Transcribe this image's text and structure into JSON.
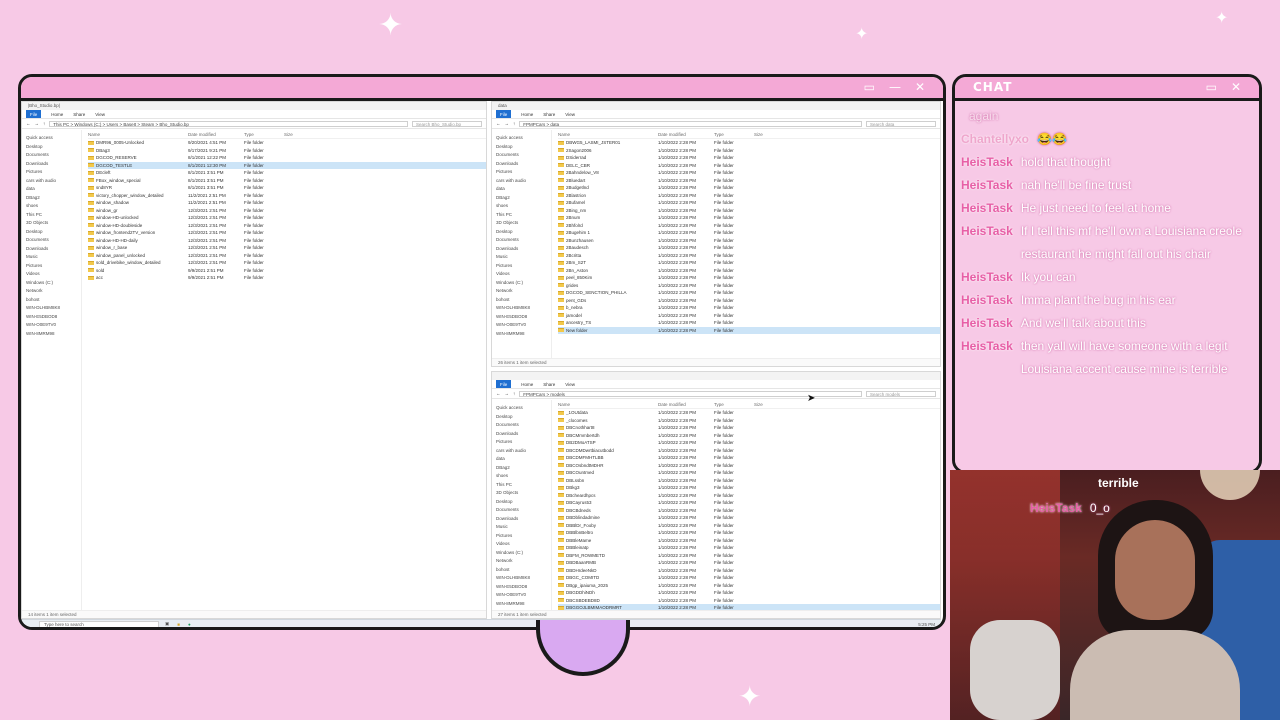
{
  "chat": {
    "title": "CHAT",
    "messages": [
      {
        "user": "",
        "text": "",
        "faded": true
      },
      {
        "user": "",
        "text": "again",
        "faded": true
      },
      {
        "user": "Chantellyxo",
        "text": "😂😂",
        "faded": true
      },
      {
        "user": "HeisTask",
        "text": "hold that thought"
      },
      {
        "user": "HeisTask",
        "text": "nah he'll be fine trust"
      },
      {
        "user": "HeisTask",
        "text": "He just need to feel at home"
      },
      {
        "user": "HeisTask",
        "text": "If I tell this mf he'll own a Louisiana creole restaurant he might fall out his chair"
      },
      {
        "user": "HeisTask",
        "text": "Ik you can"
      },
      {
        "user": "HeisTask",
        "text": "Imma plant the bug in his ear"
      },
      {
        "user": "HeisTask",
        "text": "And we'll talk about this"
      },
      {
        "user": "HeisTask",
        "text": "then yall will have someone with a legit Louisiana accent cause mine is terrible"
      }
    ],
    "overlay_last": {
      "user": "HeisTask",
      "text": "0_o"
    },
    "overlay_prev_text": "terrible"
  },
  "explorer_left": {
    "title": "|Bho_Studio.bp|",
    "ribbon": [
      "File",
      "Home",
      "Share",
      "View"
    ],
    "path": "This PC  >  Windows (C:)  >  Users  >  BaseIt  >  Steam  >  Bho_Studio.bp",
    "search": "Search Bho_Studio.bp",
    "nav": [
      "Quick access",
      "Desktop",
      "Documents",
      "Downloads",
      "Pictures",
      "cars with audio",
      "data",
      "DBag2",
      "shoes",
      "This PC",
      "3D Objects",
      "Desktop",
      "Documents",
      "Downloads",
      "Music",
      "Pictures",
      "Videos",
      "Windows (C:)",
      "Network",
      "bohost",
      "WIN-DLHBM8K8",
      "WIN-E5DBOD8",
      "WIN-O0E9TV0",
      "WIN-8MRM98"
    ],
    "headers": [
      "Name",
      "Date modified",
      "Type",
      "Size"
    ],
    "rows": [
      {
        "name": "DMR96_0005-Unlocked",
        "date": "9/20/2021 4:51 PM",
        "type": "File folder"
      },
      {
        "name": "DBag3",
        "date": "9/17/2021 9:21 PM",
        "type": "File folder"
      },
      {
        "name": "DGCOD_RESERVE",
        "date": "8/1/2021 12:22 PM",
        "type": "File folder"
      },
      {
        "name": "DGCOD_TESTLE",
        "date": "8/1/2021 12:30 PM",
        "type": "File folder",
        "selected": true
      },
      {
        "name": "DEcleft",
        "date": "8/1/2021 3:51 PM",
        "type": "File folder"
      },
      {
        "name": "FBox_window_special",
        "date": "8/1/2021 3:51 PM",
        "type": "File folder"
      },
      {
        "name": "snd8YR",
        "date": "8/1/2021 3:51 PM",
        "type": "File folder"
      },
      {
        "name": "victory_chopper_window_detailed",
        "date": "11/2/2021 2:51 PM",
        "type": "File folder"
      },
      {
        "name": "window_shadow",
        "date": "11/2/2021 2:51 PM",
        "type": "File folder"
      },
      {
        "name": "window_gr",
        "date": "12/3/2021 2:51 PM",
        "type": "File folder"
      },
      {
        "name": "window-HD-unlocked",
        "date": "12/3/2021 2:51 PM",
        "type": "File folder"
      },
      {
        "name": "window-HD-doubleside",
        "date": "12/3/2021 2:51 PM",
        "type": "File folder"
      },
      {
        "name": "window_frontend2TV_version",
        "date": "12/3/2021 2:51 PM",
        "type": "File folder"
      },
      {
        "name": "window-HD-HD-daily",
        "date": "12/3/2021 2:51 PM",
        "type": "File folder"
      },
      {
        "name": "window_r_base",
        "date": "12/3/2021 2:51 PM",
        "type": "File folder"
      },
      {
        "name": "window_panel_unlocked",
        "date": "12/3/2021 2:51 PM",
        "type": "File folder"
      },
      {
        "name": "sold_drivebike_window_detailed",
        "date": "12/3/2021 2:51 PM",
        "type": "File folder"
      },
      {
        "name": "sold",
        "date": "9/9/2021 2:51 PM",
        "type": "File folder"
      },
      {
        "name": "acc",
        "date": "9/9/2021 2:51 PM",
        "type": "File folder"
      }
    ],
    "status": "14 items  1 item selected"
  },
  "explorer_tr": {
    "title": "data",
    "ribbon": [
      "File",
      "Home",
      "Share",
      "View"
    ],
    "path": "FPMPCars  >  data",
    "search": "Search data",
    "nav": [
      "Quick access",
      "Desktop",
      "Documents",
      "Downloads",
      "Pictures",
      "cars with audio",
      "data",
      "DBag2",
      "shoes",
      "This PC",
      "3D Objects",
      "Desktop",
      "Documents",
      "Downloads",
      "Music",
      "Pictures",
      "Videos",
      "Windows (C:)",
      "Network",
      "bohost",
      "WIN-DLHBM8K8",
      "WIN-E5DBOD8",
      "WIN-O0E9TV0",
      "WIN-8MRM98"
    ],
    "headers": [
      "Name",
      "Date modified",
      "Type",
      "Size"
    ],
    "rows": [
      {
        "name": "DBWG5_LASMI_JSTER01",
        "date": "1/10/2022 2:28 PM",
        "type": "File folder"
      },
      {
        "name": "2Sagon2006",
        "date": "1/10/2022 2:28 PM",
        "type": "File folder"
      },
      {
        "name": "DSiderrad",
        "date": "1/10/2022 2:28 PM",
        "type": "File folder"
      },
      {
        "name": "DELC_CBR",
        "date": "1/10/2022 2:28 PM",
        "type": "File folder"
      },
      {
        "name": "2Bahndelow_V8",
        "date": "1/10/2022 2:28 PM",
        "type": "File folder"
      },
      {
        "name": "2Bluedart",
        "date": "1/10/2022 2:28 PM",
        "type": "File folder"
      },
      {
        "name": "2Budgetlnd",
        "date": "1/10/2022 2:28 PM",
        "type": "File folder"
      },
      {
        "name": "2Blastrion",
        "date": "1/10/2022 2:28 PM",
        "type": "File folder"
      },
      {
        "name": "2Bufamel",
        "date": "1/10/2022 2:28 PM",
        "type": "File folder"
      },
      {
        "name": "2Bing_nm",
        "date": "1/10/2022 2:28 PM",
        "type": "File folder"
      },
      {
        "name": "2Bnum",
        "date": "1/10/2022 2:28 PM",
        "type": "File folder"
      },
      {
        "name": "2Bhfolrd",
        "date": "1/10/2022 2:28 PM",
        "type": "File folder"
      },
      {
        "name": "2Bugehim 1",
        "date": "1/10/2022 2:28 PM",
        "type": "File folder"
      },
      {
        "name": "2Bunzhausen",
        "date": "1/10/2022 2:28 PM",
        "type": "File folder"
      },
      {
        "name": "2Baudesch",
        "date": "1/10/2022 2:28 PM",
        "type": "File folder"
      },
      {
        "name": "2Bcritta",
        "date": "1/10/2022 2:28 PM",
        "type": "File folder"
      },
      {
        "name": "2Bm_S2T",
        "date": "1/10/2022 2:28 PM",
        "type": "File folder"
      },
      {
        "name": "2Bn_Aston",
        "date": "1/10/2022 2:28 PM",
        "type": "File folder"
      },
      {
        "name": "peel_850Kim",
        "date": "1/10/2022 2:28 PM",
        "type": "File folder"
      },
      {
        "name": "grides",
        "date": "1/10/2022 2:28 PM",
        "type": "File folder"
      },
      {
        "name": "DGCOD_SENCTION_PHILLA",
        "date": "1/10/2022 2:28 PM",
        "type": "File folder"
      },
      {
        "name": "pent_GDs",
        "date": "1/10/2022 2:28 PM",
        "type": "File folder"
      },
      {
        "name": "b_nebra",
        "date": "1/10/2022 2:28 PM",
        "type": "File folder"
      },
      {
        "name": "jamodel",
        "date": "1/10/2022 2:28 PM",
        "type": "File folder"
      },
      {
        "name": "ancestry_TS",
        "date": "1/10/2022 2:28 PM",
        "type": "File folder"
      },
      {
        "name": "New folder",
        "date": "1/10/2022 2:28 PM",
        "type": "File folder",
        "selected": true
      }
    ],
    "status": "26 items  1 item selected"
  },
  "explorer_br": {
    "title": "",
    "ribbon": [
      "File",
      "Home",
      "Share",
      "View"
    ],
    "path": "FPMPCars  >  models",
    "search": "Search models",
    "nav": [
      "Quick access",
      "Desktop",
      "Documents",
      "Downloads",
      "Pictures",
      "cars with audio",
      "data",
      "DBag2",
      "shoes",
      "This PC",
      "3D Objects",
      "Desktop",
      "Documents",
      "Downloads",
      "Music",
      "Pictures",
      "Videos",
      "Windows (C:)",
      "Network",
      "bohost",
      "WIN-DLHBM8K8",
      "WIN-E5DBOD8",
      "WIN-O0E9TV0",
      "WIN-8MRM98"
    ],
    "headers": [
      "Name",
      "Date modified",
      "Type",
      "Size"
    ],
    "rows": [
      {
        "name": "_1OUtdata",
        "date": "1/10/2022 2:28 PM",
        "type": "File folder"
      },
      {
        "name": "_clocomes",
        "date": "1/10/2022 2:28 PM",
        "type": "File folder"
      },
      {
        "name": "DBCnothhart8",
        "date": "1/10/2022 2:28 PM",
        "type": "File folder"
      },
      {
        "name": "DBCMmmbertdh",
        "date": "1/10/2022 2:28 PM",
        "type": "File folder"
      },
      {
        "name": "DB2DMoATSP",
        "date": "1/10/2022 2:28 PM",
        "type": "File folder"
      },
      {
        "name": "DBCDMDwrtbiacutbodd",
        "date": "1/10/2022 2:28 PM",
        "type": "File folder"
      },
      {
        "name": "DBCDMFMHTLBB",
        "date": "1/10/2022 2:28 PM",
        "type": "File folder"
      },
      {
        "name": "DBCOsbndtMDHR",
        "date": "1/10/2022 2:28 PM",
        "type": "File folder"
      },
      {
        "name": "DBCOuntmed",
        "date": "1/10/2022 2:28 PM",
        "type": "File folder"
      },
      {
        "name": "DBLssbn",
        "date": "1/10/2022 2:28 PM",
        "type": "File folder"
      },
      {
        "name": "DBkg3",
        "date": "1/10/2022 2:28 PM",
        "type": "File folder"
      },
      {
        "name": "DBcheardhpcs",
        "date": "1/10/2022 2:28 PM",
        "type": "File folder"
      },
      {
        "name": "DBCayrus53",
        "date": "1/10/2022 2:28 PM",
        "type": "File folder"
      },
      {
        "name": "DBCBdneds",
        "date": "1/10/2022 2:28 PM",
        "type": "File folder"
      },
      {
        "name": "DBDblindadmine",
        "date": "1/10/2022 2:28 PM",
        "type": "File folder"
      },
      {
        "name": "DBBlDr_Fooby",
        "date": "1/10/2022 2:28 PM",
        "type": "File folder"
      },
      {
        "name": "DBBlbnBeltro",
        "date": "1/10/2022 2:28 PM",
        "type": "File folder"
      },
      {
        "name": "DBBleMame",
        "date": "1/10/2022 2:28 PM",
        "type": "File folder"
      },
      {
        "name": "DBBleinatp",
        "date": "1/10/2022 2:28 PM",
        "type": "File folder"
      },
      {
        "name": "DBFM_ROWMETD",
        "date": "1/10/2022 2:28 PM",
        "type": "File folder"
      },
      {
        "name": "DBDBaanRMB",
        "date": "1/10/2022 2:28 PM",
        "type": "File folder"
      },
      {
        "name": "DBDHrdeeNkD",
        "date": "1/10/2022 2:28 PM",
        "type": "File folder"
      },
      {
        "name": "DBGC_COMITD",
        "date": "1/10/2022 2:28 PM",
        "type": "File folder"
      },
      {
        "name": "DBgp_ipaiuma_2025",
        "date": "1/10/2022 2:28 PM",
        "type": "File folder"
      },
      {
        "name": "DBGDDhiNDh",
        "date": "1/10/2022 2:28 PM",
        "type": "File folder"
      },
      {
        "name": "DBCSBDEBD8D",
        "date": "1/10/2022 2:28 PM",
        "type": "File folder"
      },
      {
        "name": "DBGGOJLBMIMAODRMRT",
        "date": "1/10/2022 2:28 PM",
        "type": "File folder",
        "selected": true
      }
    ],
    "status": "27 items  1 item selected"
  },
  "taskbar": {
    "search": "Type here to search",
    "tray": "5:25 PM"
  },
  "icons": {
    "frame_minimize": "minimize-icon",
    "frame_maximize": "maximize-icon",
    "frame_close": "close-icon",
    "sparkle": "sparkle-icon"
  },
  "colors": {
    "background": "#f7c9e6",
    "frame_bar": "#f4a9d6",
    "username": "#e75fa6",
    "explorer_accent": "#1f6fd1"
  }
}
